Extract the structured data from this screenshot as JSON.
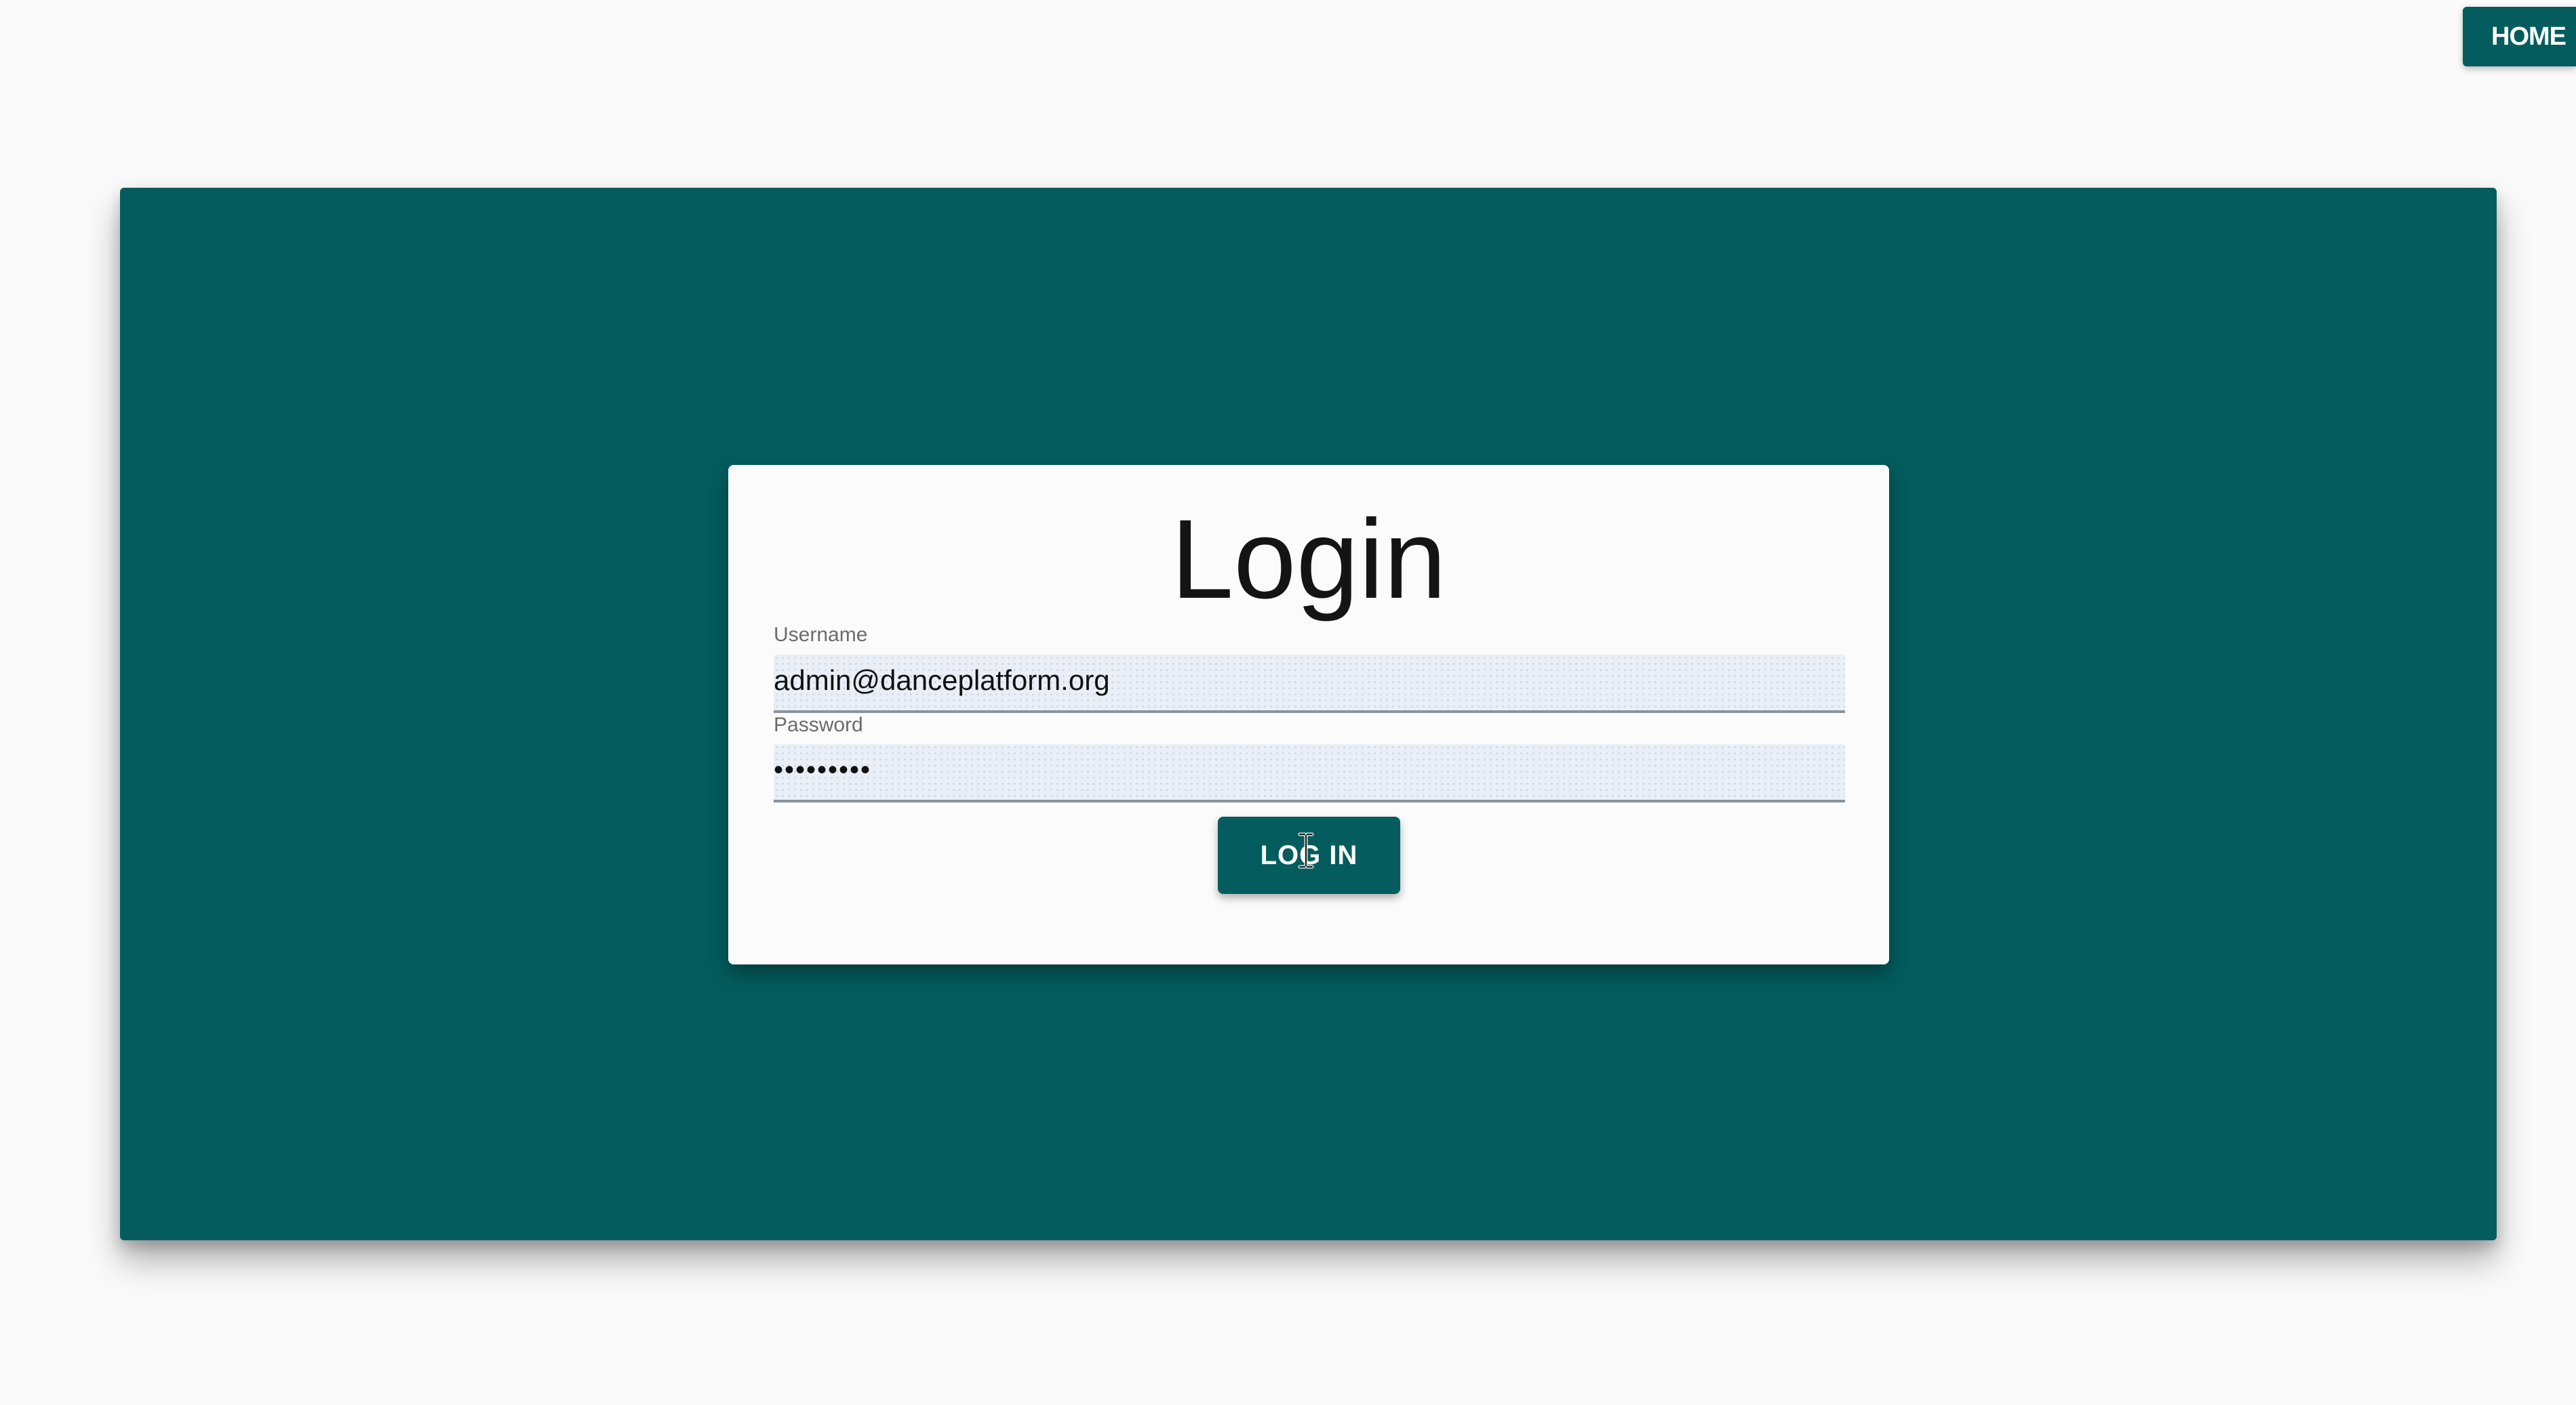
{
  "nav": {
    "home_label": "HOME"
  },
  "login": {
    "title": "Login",
    "username_label": "Username",
    "username_value": "admin@danceplatform.org",
    "password_label": "Password",
    "password_value": "•••••••••",
    "submit_label": "LOG IN"
  },
  "colors": {
    "brand_teal": "#045c5e",
    "page_background": "#fafafa",
    "card_background": "#fbfbfc",
    "input_background": "#e9eef7"
  },
  "icons": {
    "cursor": "text-cursor-icon"
  }
}
